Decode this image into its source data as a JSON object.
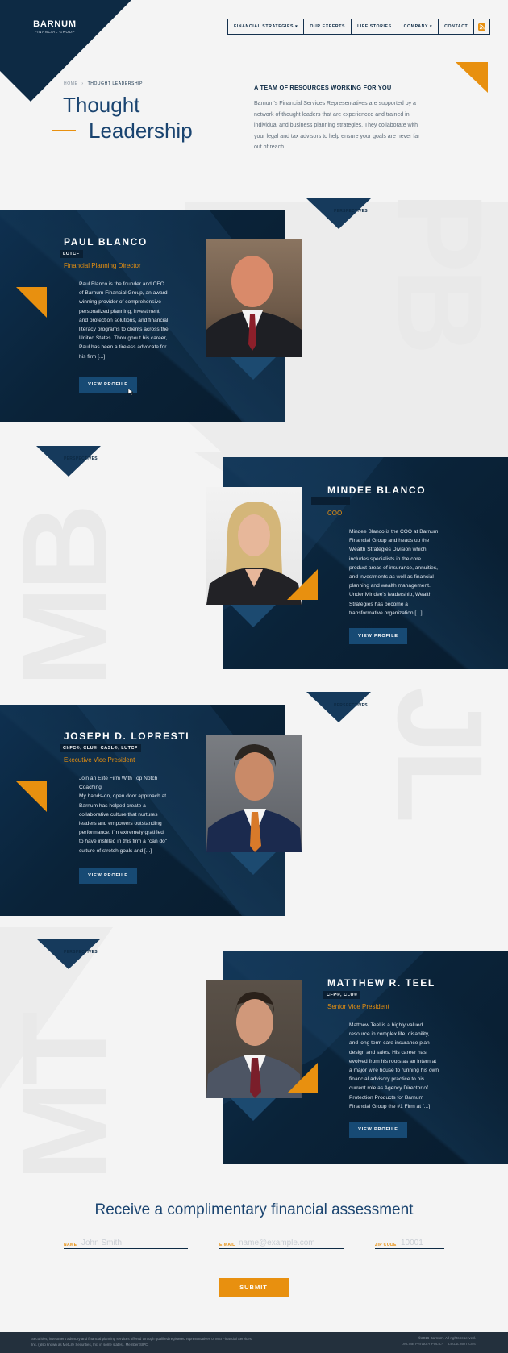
{
  "header": {
    "logo_main": "BARNUM",
    "logo_sub": "FINANCIAL GROUP",
    "nav": [
      "FINANCIAL STRATEGIES ▾",
      "OUR EXPERTS",
      "LIFE STORIES",
      "COMPANY ▾",
      "CONTACT"
    ],
    "rss_icon": "rss-icon"
  },
  "hero": {
    "breadcrumb_home": "HOME",
    "breadcrumb_sep": "›",
    "breadcrumb_current": "THOUGHT LEADERSHIP",
    "title_line1": "Thought",
    "title_line2": "Leadership",
    "intro_heading": "A TEAM OF RESOURCES WORKING FOR YOU",
    "intro_text": "Barnum's Financial Services Representatives are supported by a network of thought leaders that are experienced and trained in individual and business planning strategies. They collaborate with your legal and tax advisors to help ensure your goals are never far out of reach."
  },
  "perspectives_label": "PERSPECTIVES",
  "experts": [
    {
      "initials": "PB",
      "name": "PAUL BLANCO",
      "credentials": "LUTCF",
      "role": "Financial Planning Director",
      "bio": "Paul Blanco is the founder and CEO of Barnum Financial Group, an award winning provider of comprehensive personalized planning, investment and protection solutions, and financial literacy programs to clients across the United States. Throughout his career, Paul has been a tireless advocate for his firm [...]",
      "button": "VIEW PROFILE"
    },
    {
      "initials": "MB",
      "name": "MINDEE BLANCO",
      "credentials": "",
      "role": "COO",
      "bio": "Mindee Blanco is the COO at Barnum Financial Group and heads up the Wealth Strategies Division which includes specialists in the core product areas of insurance, annuities, and investments as well as financial planning and wealth management. Under Mindee's leadership, Wealth Strategies has become a transformative organization [...]",
      "button": "VIEW PROFILE"
    },
    {
      "initials": "JL",
      "name": "JOSEPH D. LOPRESTI",
      "credentials": "ChFC®, CLU®, CASL®, LUTCF",
      "role": "Executive Vice President",
      "bio": "Join an Elite Firm With Top Notch Coaching\nMy hands-on, open door approach at Barnum has helped create a collaborative culture that nurtures leaders and empowers outstanding performance. I'm extremely gratified to have instilled in this firm a \"can do\" culture of stretch goals and [...]",
      "button": "VIEW PROFILE"
    },
    {
      "initials": "MT",
      "name": "MATTHEW R. TEEL",
      "credentials": "CFP®, CLU®",
      "role": "Senior Vice President",
      "bio": "Matthew Teel is a highly valued resource in complex life, disability, and long term care insurance plan design and sales. His career has evolved from his roots as an intern at a major wire house to running his own financial advisory practice to his current role as Agency Director of Protection Products for Barnum Financial Group the #1 Firm at [...]",
      "button": "VIEW PROFILE"
    }
  ],
  "form": {
    "heading": "Receive a complimentary financial assessment",
    "name_label": "NAME",
    "name_placeholder": "John Smith",
    "email_label": "E-MAIL",
    "email_placeholder": "name@example.com",
    "zip_label": "ZIP CODE",
    "zip_placeholder": "10001",
    "submit": "SUBMIT"
  },
  "footer": {
    "disclaimer": "Securities, investment advisory and financial planning services offered through qualified registered representatives of MSI Financial Services, Inc. (also known as MetLife Securities, Inc. in some states). Member SIPC.",
    "copyright": "©2016 Barnum. All rights reserved.",
    "links": "ONLINE PRIVACY POLICY    LEGAL NOTICES"
  },
  "colors": {
    "navy": "#0d2a44",
    "orange": "#e8900f",
    "background": "#f4f4f4"
  }
}
